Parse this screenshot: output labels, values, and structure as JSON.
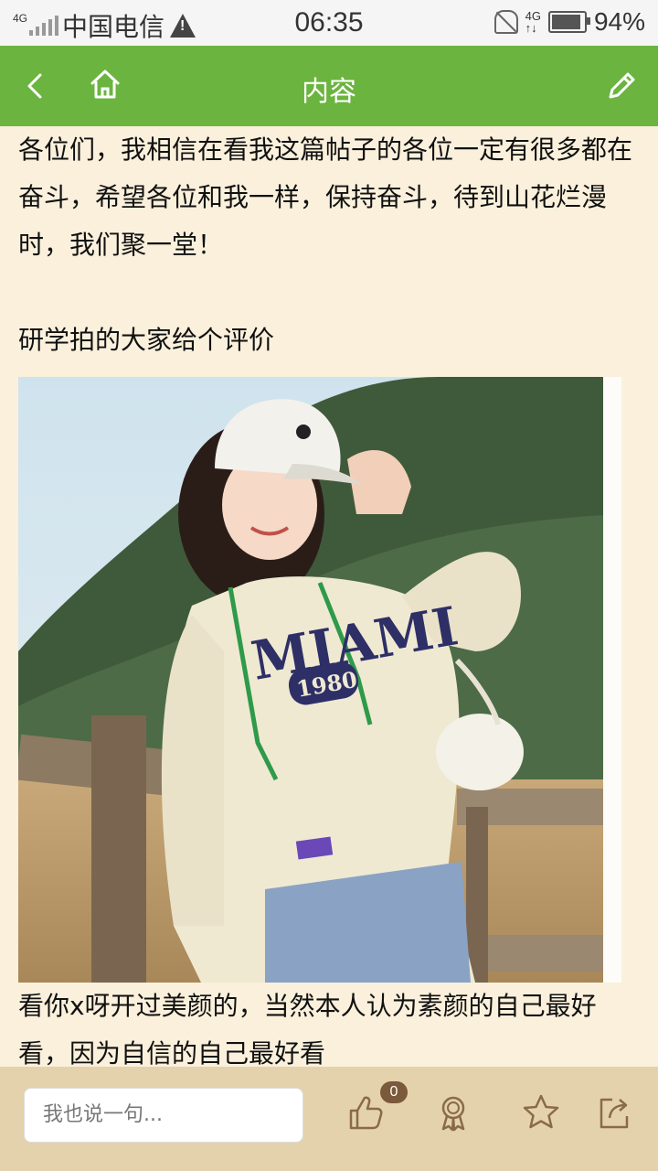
{
  "status_bar": {
    "network": "4G",
    "carrier": "中国电信",
    "time": "06:35",
    "network_right": "4G",
    "battery": "94%"
  },
  "nav": {
    "title": "内容"
  },
  "post": {
    "paragraph_1": "各位们，我相信在看我这篇帖子的各位一定有很多都在奋斗，希望各位和我一样，保持奋斗，待到山花烂漫时，我们聚一堂！",
    "paragraph_2": "研学拍的大家给个评价",
    "photo": {
      "shirt_text": "MIAMI",
      "shirt_year": "1980"
    },
    "paragraph_3": "看你x呀开过美颜的，当然本人认为素颜的自己最好看，因为自信的自己最好看"
  },
  "bottom_bar": {
    "comment_placeholder": "我也说一句...",
    "like_count": "0"
  },
  "colors": {
    "nav_green": "#6bb43f",
    "page_bg": "#faf0dc",
    "bottom_bg": "#e4d2ad",
    "icon_brown": "#8a6a4a"
  }
}
